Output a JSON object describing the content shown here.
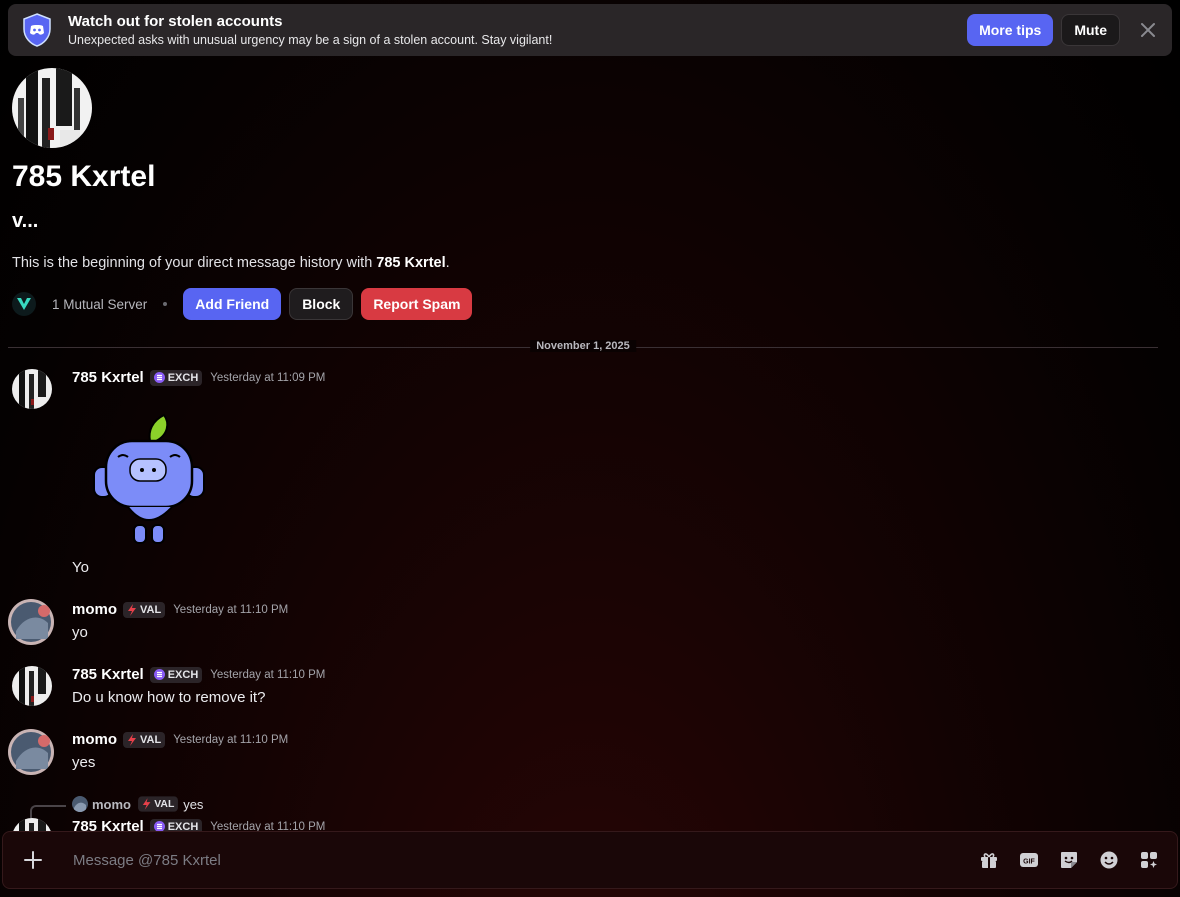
{
  "banner": {
    "title": "Watch out for stolen accounts",
    "subtitle": "Unexpected asks with unusual urgency may be a sign of a stolen account. Stay vigilant!",
    "more_tips": "More tips",
    "mute": "Mute"
  },
  "profile": {
    "name": "785 Kxrtel",
    "handle": "v...",
    "beginning_prefix": "This is the beginning of your direct message history with ",
    "beginning_name": "785 Kxrtel",
    "beginning_suffix": ".",
    "mutual": "1 Mutual Server",
    "add_friend": "Add Friend",
    "block": "Block",
    "report_spam": "Report Spam"
  },
  "divider_date": "November 1, 2025",
  "messages": [
    {
      "author": "785 Kxrtel",
      "tag": "EXCH",
      "time": "Yesterday at 11:09 PM",
      "text": "Yo",
      "has_sticker": true
    },
    {
      "author": "momo",
      "tag": "VAL",
      "time": "Yesterday at 11:10 PM",
      "text": "yo"
    },
    {
      "author": "785 Kxrtel",
      "tag": "EXCH",
      "time": "Yesterday at 11:10 PM",
      "text": "Do u know how to remove it?"
    },
    {
      "author": "momo",
      "tag": "VAL",
      "time": "Yesterday at 11:10 PM",
      "text": "yes"
    },
    {
      "author": "785 Kxrtel",
      "tag": "EXCH",
      "time": "Yesterday at 11:10 PM",
      "text": ""
    }
  ],
  "reply": {
    "author": "momo",
    "tag": "VAL",
    "text": "yes"
  },
  "composer": {
    "placeholder": "Message @785 Kxrtel",
    "tools": [
      "gift-icon",
      "gif-icon",
      "sticker-icon",
      "emoji-icon",
      "apps-icon"
    ]
  },
  "colors": {
    "accent": "#5865f2",
    "danger": "#d83a42",
    "exch_tag": "#8a5cf6",
    "val_tag": "#e8404a"
  }
}
